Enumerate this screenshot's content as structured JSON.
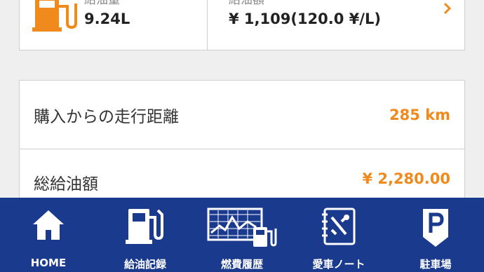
{
  "summary": {
    "volume_label": "給油量",
    "volume_value": "9.24L",
    "amount_label": "給油額",
    "amount_value": "¥ 1,109(120.0 ¥/L)"
  },
  "stats": [
    {
      "label": "購入からの走行距離",
      "value": "285 km"
    },
    {
      "label": "総給油額",
      "value": "¥ 2,280.00"
    }
  ],
  "tabs": [
    {
      "label": "HOME",
      "icon": "home-icon"
    },
    {
      "label": "給油記録",
      "icon": "fuel-pump-icon"
    },
    {
      "label": "燃費履歴",
      "icon": "fuel-history-chart-icon"
    },
    {
      "label": "愛車ノート",
      "icon": "car-notebook-icon"
    },
    {
      "label": "駐車場",
      "icon": "parking-icon"
    }
  ],
  "colors": {
    "accent": "#f08a1c",
    "tabbar": "#1a3a8e",
    "background": "#efefef"
  }
}
